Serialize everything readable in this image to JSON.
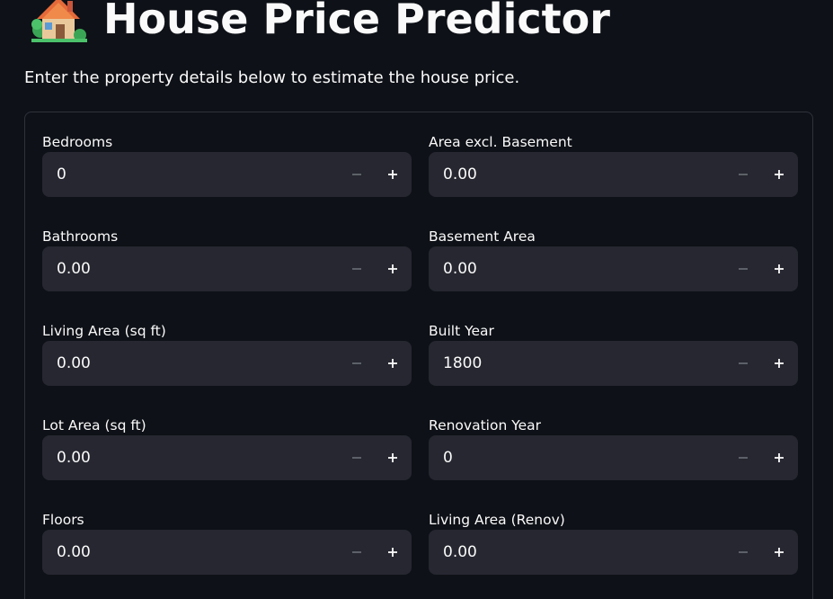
{
  "header": {
    "title": "House Price Predictor",
    "icon": "house-icon",
    "subtitle": "Enter the property details below to estimate the house price."
  },
  "form": {
    "fields": [
      {
        "id": "bedrooms",
        "label": "Bedrooms",
        "value": "0"
      },
      {
        "id": "area-excl-basement",
        "label": "Area excl. Basement",
        "value": "0.00"
      },
      {
        "id": "bathrooms",
        "label": "Bathrooms",
        "value": "0.00"
      },
      {
        "id": "basement-area",
        "label": "Basement Area",
        "value": "0.00"
      },
      {
        "id": "living-area",
        "label": "Living Area (sq ft)",
        "value": "0.00"
      },
      {
        "id": "built-year",
        "label": "Built Year",
        "value": "1800"
      },
      {
        "id": "lot-area",
        "label": "Lot Area (sq ft)",
        "value": "0.00"
      },
      {
        "id": "renovation-year",
        "label": "Renovation Year",
        "value": "0"
      },
      {
        "id": "floors",
        "label": "Floors",
        "value": "0.00"
      },
      {
        "id": "living-area-renov",
        "label": "Living Area (Renov)",
        "value": "0.00"
      }
    ],
    "stepper_icons": {
      "decrement": "minus-icon",
      "increment": "plus-icon"
    }
  },
  "colors": {
    "background": "#0e1117",
    "input_background": "#262730",
    "border": "#2f323b",
    "text": "#fafafa",
    "disabled_icon": "#6b6e76"
  }
}
